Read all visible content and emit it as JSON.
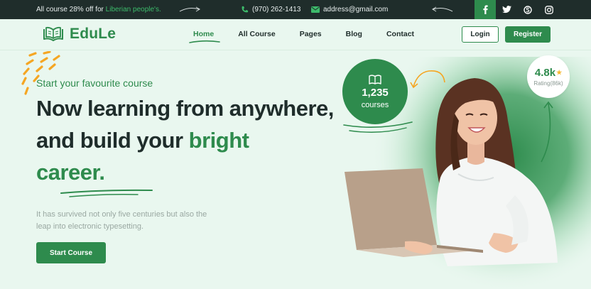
{
  "topbar": {
    "offer_prefix": "All course 28% off for",
    "offer_accent": "Liberian people's.",
    "phone": "(970) 262-1413",
    "email": "address@gmail.com",
    "social": [
      "facebook-icon",
      "twitter-icon",
      "skype-icon",
      "instagram-icon"
    ]
  },
  "header": {
    "brand": "EduLe",
    "nav": [
      {
        "label": "Home",
        "active": true
      },
      {
        "label": "All Course"
      },
      {
        "label": "Pages"
      },
      {
        "label": "Blog"
      },
      {
        "label": "Contact"
      }
    ],
    "login_label": "Login",
    "register_label": "Register"
  },
  "hero": {
    "subtitle": "Start your favourite course",
    "line1": "Now learning from anywhere,",
    "line2_prefix": "and build your ",
    "line2_accent": "bright",
    "line3": "career.",
    "description": "It has survived not only five centuries but also the leap into electronic typesetting.",
    "cta_label": "Start Course"
  },
  "stats": {
    "courses_count": "1,235",
    "courses_label": "courses",
    "rating_value": "4.8k",
    "rating_label": "Rating(86k)"
  },
  "colors": {
    "accent": "#2e8b4d",
    "dark": "#1f2d2b",
    "background": "#e9f7ef",
    "star": "#f5b82e"
  }
}
